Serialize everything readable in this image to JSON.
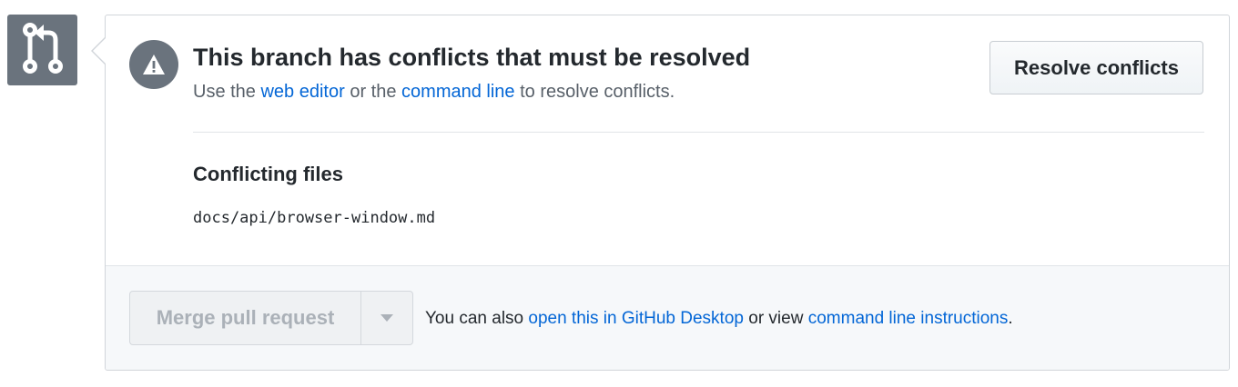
{
  "pr_status": {
    "icon": "git-pull-request-icon",
    "badge_color": "#6a737d"
  },
  "conflict_notice": {
    "icon": "alert-icon",
    "title": "This branch has conflicts that must be resolved",
    "subtitle": {
      "prefix": "Use the ",
      "link_web_editor": "web editor",
      "middle": " or the ",
      "link_command_line": "command line",
      "suffix": " to resolve conflicts."
    },
    "resolve_button_label": "Resolve conflicts"
  },
  "conflicting_files": {
    "heading": "Conflicting files",
    "files": [
      "docs/api/browser-window.md"
    ]
  },
  "merge": {
    "button_label": "Merge pull request",
    "caret_icon": "triangle-down-icon",
    "disabled": true,
    "alternatives": {
      "prefix": "You can also ",
      "link_desktop": "open this in GitHub Desktop",
      "middle": " or view ",
      "link_instructions": "command line instructions",
      "suffix": "."
    }
  },
  "colors": {
    "link": "#0366d6",
    "muted_text": "#586069",
    "text": "#24292e",
    "icon_gray": "#6a737d",
    "footer_bg": "#f6f8fa"
  }
}
